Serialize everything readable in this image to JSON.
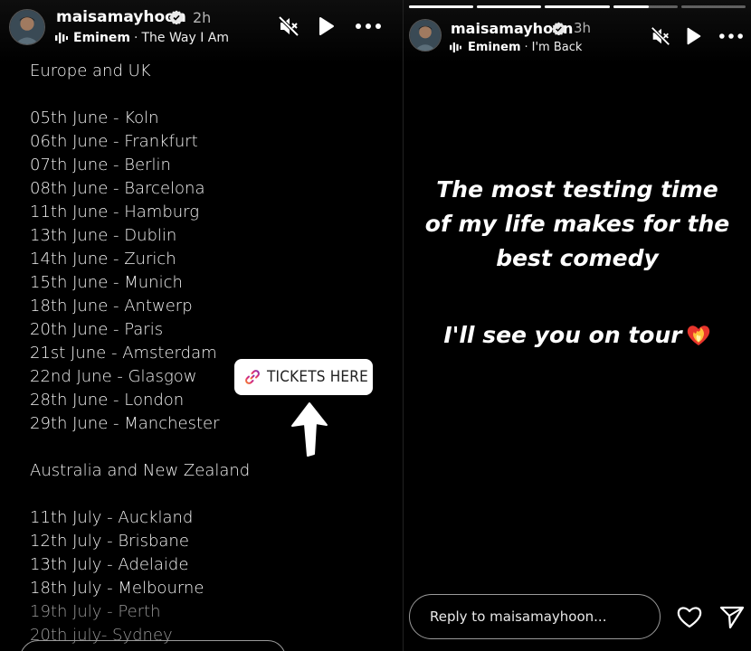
{
  "left_story": {
    "username": "maisamayhoon",
    "time": "2h",
    "music_artist": "Eminem",
    "music_separator": "·",
    "music_song": "The Way I Am",
    "tour_lines": [
      "Europe and UK",
      "",
      "05th June - Koln",
      "06th June - Frankfurt",
      "07th June - Berlin",
      "08th June - Barcelona",
      "11th June - Hamburg",
      "13th June - Dublin",
      "14th June - Zurich",
      "15th June - Munich",
      "18th June - Antwerp",
      "20th June - Paris",
      "21st June - Amsterdam",
      "22nd June - Glasgow",
      "28th June - London",
      "29th June - Manchester",
      "",
      "Australia and New Zealand",
      "",
      "11th July - Auckland",
      "12th July - Brisbane",
      "13th July - Adelaide",
      "18th July - Melbourne",
      "19th July - Perth",
      "20th july- Sydney"
    ],
    "tickets_label": "TICKETS HERE"
  },
  "right_story": {
    "username": "maisamayhoon",
    "time": "3h",
    "music_artist": "Eminem",
    "music_separator": "·",
    "music_song": "I'm Back",
    "text_lines": [
      "The most testing time",
      "of my life makes for the",
      "best comedy"
    ],
    "tour_line": "I'll see you on tour",
    "reply_placeholder": "Reply to maisamayhoon...",
    "progress": [
      1,
      1,
      1,
      0.55,
      0
    ]
  },
  "icons": {
    "verified": "verified-badge-icon",
    "mute": "muted-speaker-icon",
    "play": "play-icon",
    "more": "more-horizontal-icon",
    "link": "link-icon",
    "arrow": "up-arrow-icon",
    "emoji": "heart-on-fire-emoji",
    "like": "heart-icon",
    "send": "send-icon"
  },
  "colors": {
    "background": "#000000",
    "verified": "#3897f0",
    "muted_text": "#b5b5b5"
  }
}
